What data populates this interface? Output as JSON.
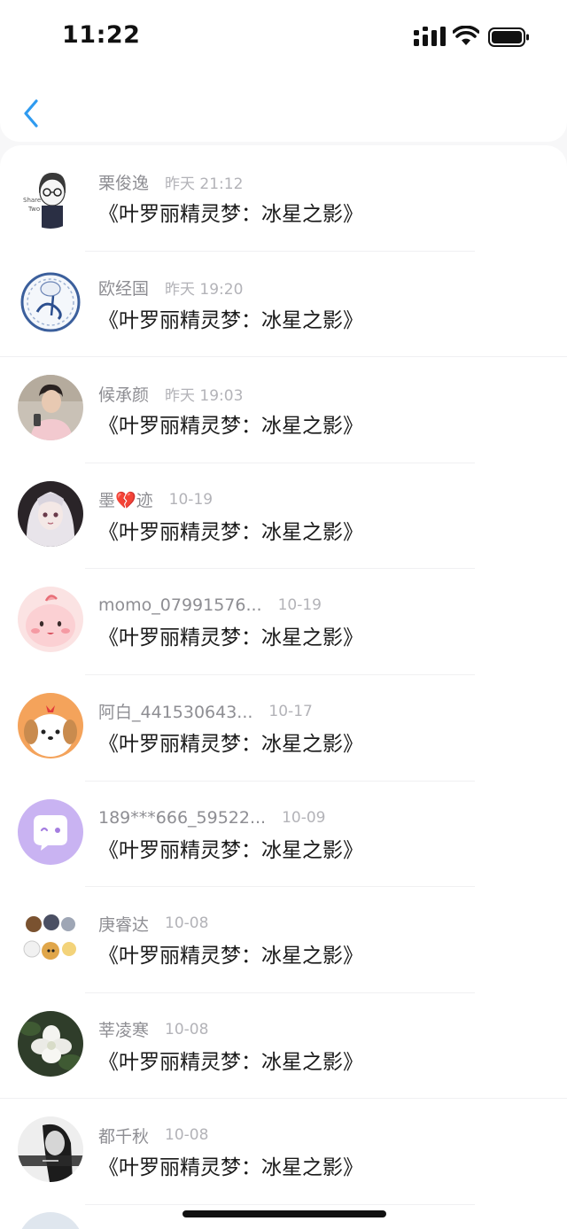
{
  "status_bar": {
    "time": "11:22",
    "signal_icon": "cellular-signal-icon",
    "wifi_icon": "wifi-icon",
    "battery_icon": "battery-icon"
  },
  "nav": {
    "back_icon": "chevron-left-icon",
    "accent_color": "#2f9bf0"
  },
  "message_text": "《叶罗丽精灵梦：冰星之影》",
  "items": [
    {
      "name": "栗俊逸",
      "date": "昨天 21:12",
      "message": "《叶罗丽精灵梦：冰星之影》",
      "avatar": "avatar-sketch-boy"
    },
    {
      "name": "欧经国",
      "date": "昨天 19:20",
      "message": "《叶罗丽精灵梦：冰星之影》",
      "avatar": "avatar-porcelain-plate"
    },
    {
      "name": "候承颜",
      "date": "昨天 19:03",
      "message": "《叶罗丽精灵梦：冰星之影》",
      "avatar": "avatar-selfie-boy"
    },
    {
      "name": "墨💔迹",
      "date": "10-19",
      "message": "《叶罗丽精灵梦：冰星之影》",
      "avatar": "avatar-anime-girl"
    },
    {
      "name": "momo_07991576...",
      "date": "10-19",
      "message": "《叶罗丽精灵梦：冰星之影》",
      "avatar": "avatar-pink-blob"
    },
    {
      "name": "阿白_441530643...",
      "date": "10-17",
      "message": "《叶罗丽精灵梦：冰星之影》",
      "avatar": "avatar-puppy"
    },
    {
      "name": "189***666_59522...",
      "date": "10-09",
      "message": "《叶罗丽精灵梦：冰星之影》",
      "avatar": "avatar-default-purple"
    },
    {
      "name": "庚睿达",
      "date": "10-08",
      "message": "《叶罗丽精灵梦：冰星之影》",
      "avatar": "avatar-cartoon-animals"
    },
    {
      "name": "莘凌寒",
      "date": "10-08",
      "message": "《叶罗丽精灵梦：冰星之影》",
      "avatar": "avatar-white-flower"
    },
    {
      "name": "都千秋",
      "date": "10-08",
      "message": "《叶罗丽精灵梦：冰星之影》",
      "avatar": "avatar-bw-girl"
    }
  ]
}
